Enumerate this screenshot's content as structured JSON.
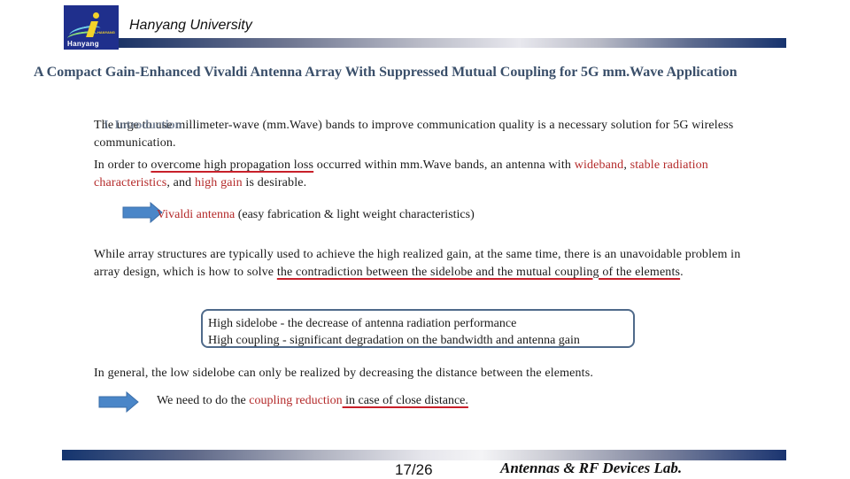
{
  "header": {
    "logo_text": "Hanyang",
    "logo_small_text": "HANYANG",
    "university_name": "Hanyang University"
  },
  "title": "A Compact Gain-Enhanced Vivaldi Antenna Array With Suppressed Mutual Coupling for 5G mm.Wave Application",
  "section_heading": "I. Introduction",
  "paragraph1": "The urge to use millimeter-wave (mm.Wave) bands to improve communication quality is a necessary solution for 5G wireless communication.",
  "paragraph2": {
    "t1": "In order to ",
    "u1": "overcome high propagation loss",
    "t2": " occurred within mm.Wave bands, an antenna with ",
    "r1": "wideband",
    "t3": ", ",
    "r2": "stable radiation characteristics",
    "t4": ", and ",
    "r3": "high gain",
    "t5": " is desirable."
  },
  "vivaldi_line": {
    "red": "Vivaldi antenna",
    "rest": " (easy fabrication & light weight characteristics)"
  },
  "paragraph3": {
    "t1": "While array structures are typically used to achieve the high realized gain, at the same time, there is an unavoidable problem in array design, which is how to solve ",
    "u1": "the contradiction between the sidelobe and the mutual coupling of the elements",
    "t2": "."
  },
  "callout": {
    "line1": "High sidelobe - the decrease of antenna radiation performance",
    "line2": "High coupling - significant degradation on the bandwidth and antenna gain"
  },
  "paragraph4": "In general, the low sidelobe can only be realized by decreasing the distance between the elements.",
  "need_line": {
    "t1": "We need to do the ",
    "red": "coupling reduction",
    "u1": " in case of close distance."
  },
  "footer": {
    "page_number": "17/26",
    "lab_name": "Antennas & RF Devices Lab."
  },
  "colors": {
    "accent_red": "#b42a2a",
    "title_blue": "#3a4f6a",
    "arrow_blue": "#4a86c8",
    "callout_border": "#4f6a8a"
  }
}
